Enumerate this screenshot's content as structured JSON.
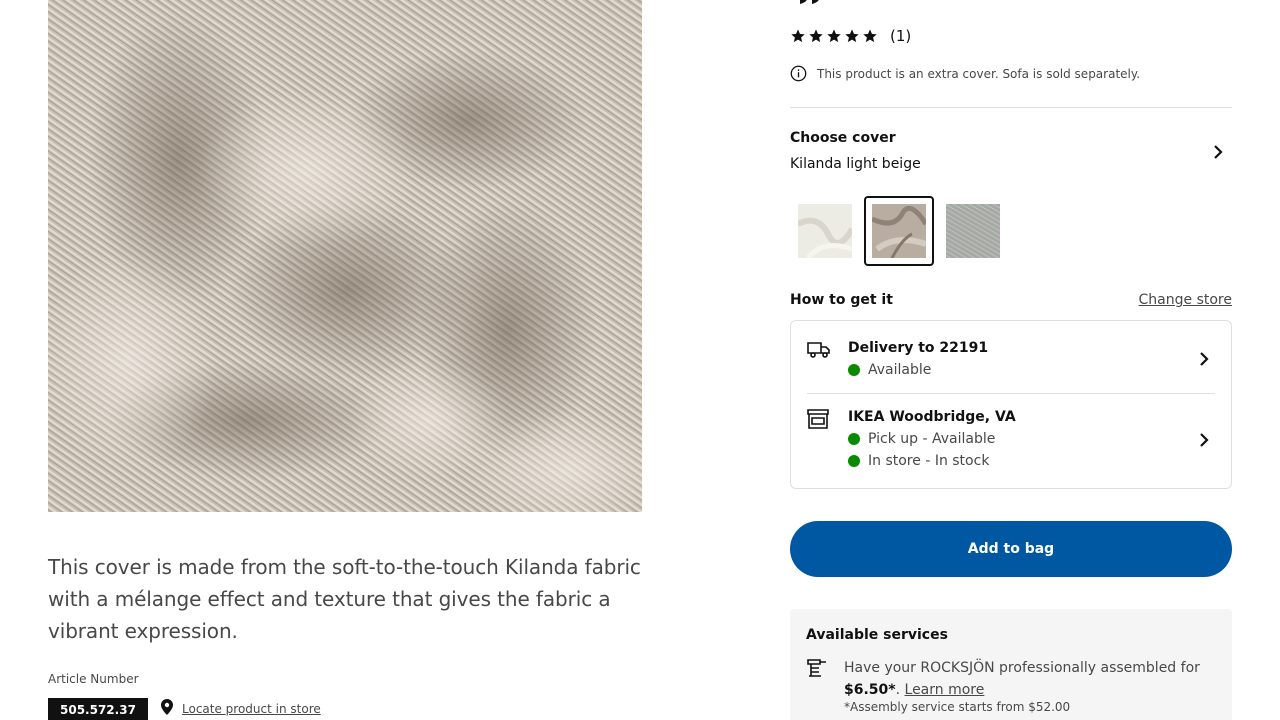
{
  "product": {
    "rating_count": "(1)",
    "rating_value": 5,
    "rating_max": 5,
    "info_note": "This product is an extra cover. Sofa is sold separately.",
    "description": "This cover is made from the soft-to-the-touch Kilanda fabric with a mélange effect and texture that gives the fabric a vibrant expression.",
    "article_label": "Article Number",
    "article_number": "505.572.37",
    "locate_label": "Locate product in store"
  },
  "cover": {
    "title": "Choose cover",
    "selected": "Kilanda light beige",
    "swatches": [
      {
        "name": "Kilanda off-white swatch",
        "color": "#ecebe4"
      },
      {
        "name": "Kilanda light beige swatch",
        "color": "#b9ada2",
        "selected": true
      },
      {
        "name": "Kilanda grey swatch",
        "color": "#a6aaa4"
      }
    ]
  },
  "get_it": {
    "title": "How to get it",
    "change_store": "Change store",
    "delivery": {
      "title": "Delivery to 22191",
      "status": "Available"
    },
    "store": {
      "title": "IKEA Woodbridge, VA",
      "pickup": "Pick up - Available",
      "instore": "In store - In stock"
    }
  },
  "cta": {
    "add_to_bag": "Add to bag"
  },
  "services": {
    "title": "Available services",
    "text_before": "Have your ROCKSJÖN professionally assembled for ",
    "price": "$6.50*",
    "text_after": ". ",
    "learn_more": "Learn more",
    "note": "*Assembly service starts from $52.00"
  },
  "colors": {
    "primary_blue": "#0058a3",
    "status_green": "#0a8a00",
    "text_dark": "#111111",
    "text_muted": "#484848"
  },
  "icons": [
    "star-icon",
    "info-icon",
    "chevron-right-icon",
    "truck-icon",
    "store-icon",
    "location-pin-icon",
    "assembly-icon"
  ]
}
